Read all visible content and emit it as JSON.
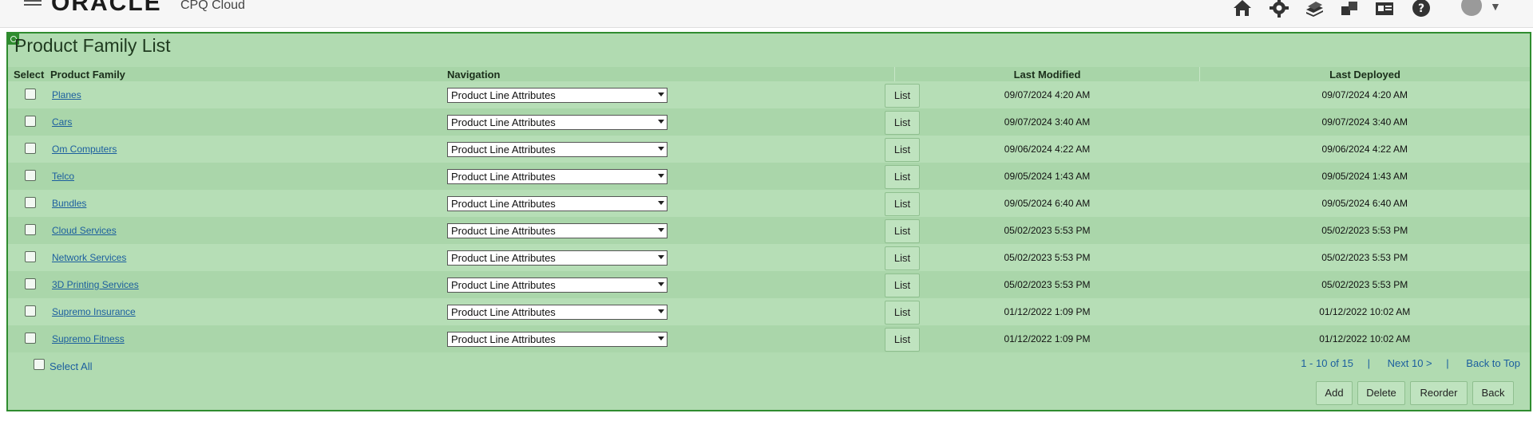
{
  "header": {
    "brand": "ORACLE",
    "app_name": "CPQ Cloud",
    "icons": [
      "home-icon",
      "gear-icon",
      "stack-icon",
      "boxes-icon",
      "id-card-icon",
      "help-icon",
      "user-avatar",
      "caret-down-icon"
    ]
  },
  "page": {
    "title": "Product Family List",
    "columns": {
      "select": "Select",
      "product_family": "Product Family",
      "navigation": "Navigation",
      "last_modified": "Last Modified",
      "last_deployed": "Last Deployed"
    },
    "list_label": "List",
    "rows": [
      {
        "name": "Planes",
        "navigation": "Product Line Attributes",
        "last_modified": "09/07/2024 4:20 AM",
        "last_deployed": "09/07/2024 4:20 AM"
      },
      {
        "name": "Cars",
        "navigation": "Product Line Attributes",
        "last_modified": "09/07/2024 3:40 AM",
        "last_deployed": "09/07/2024 3:40 AM"
      },
      {
        "name": "Om Computers",
        "navigation": "Product Line Attributes",
        "last_modified": "09/06/2024 4:22 AM",
        "last_deployed": "09/06/2024 4:22 AM"
      },
      {
        "name": "Telco",
        "navigation": "Product Line Attributes",
        "last_modified": "09/05/2024 1:43 AM",
        "last_deployed": "09/05/2024 1:43 AM"
      },
      {
        "name": "Bundles",
        "navigation": "Product Line Attributes",
        "last_modified": "09/05/2024 6:40 AM",
        "last_deployed": "09/05/2024 6:40 AM"
      },
      {
        "name": "Cloud Services",
        "navigation": "Product Line Attributes",
        "last_modified": "05/02/2023 5:53 PM",
        "last_deployed": "05/02/2023 5:53 PM"
      },
      {
        "name": "Network Services",
        "navigation": "Product Line Attributes",
        "last_modified": "05/02/2023 5:53 PM",
        "last_deployed": "05/02/2023 5:53 PM"
      },
      {
        "name": "3D Printing Services",
        "navigation": "Product Line Attributes",
        "last_modified": "05/02/2023 5:53 PM",
        "last_deployed": "05/02/2023 5:53 PM"
      },
      {
        "name": "Supremo Insurance",
        "navigation": "Product Line Attributes",
        "last_modified": "01/12/2022 1:09 PM",
        "last_deployed": "01/12/2022 10:02 AM"
      },
      {
        "name": "Supremo Fitness",
        "navigation": "Product Line Attributes",
        "last_modified": "01/12/2022 1:09 PM",
        "last_deployed": "01/12/2022 10:02 AM"
      }
    ],
    "select_all": "Select All",
    "pager": {
      "range": "1 - 10 of 15",
      "sep": "|",
      "next": "Next 10 >",
      "back_to_top": "Back to Top"
    },
    "actions": {
      "add": "Add",
      "delete": "Delete",
      "reorder": "Reorder",
      "back": "Back"
    }
  },
  "colors": {
    "panel_bg": "#b1dbb1",
    "panel_border": "#2f8c2f",
    "link": "#1b5e9e"
  }
}
